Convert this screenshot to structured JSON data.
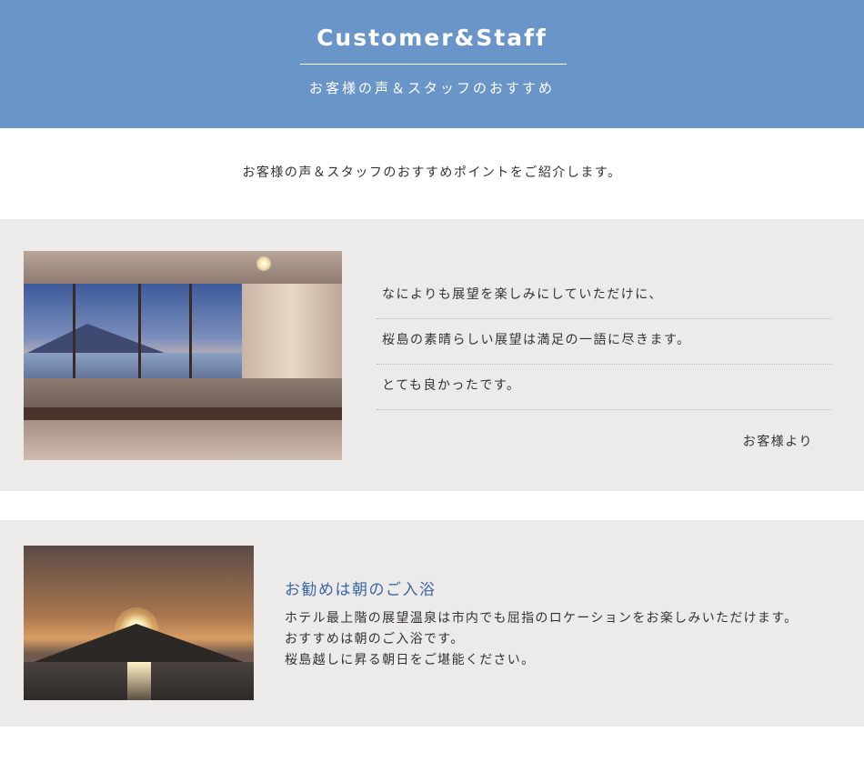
{
  "header": {
    "title": "Customer&Staff",
    "subtitle": "お客様の声＆スタッフのおすすめ",
    "background_color": "#6a95c8"
  },
  "intro": "お客様の声＆スタッフのおすすめポイントをご紹介します。",
  "customer_voice": {
    "lines": [
      "なによりも展望を楽しみにしていただけに、",
      "桜島の素晴らしい展望は満足の一語に尽きます。",
      "とても良かったです。"
    ],
    "signature": "お客様より"
  },
  "staff_recommendation": {
    "heading": "お勧めは朝のご入浴",
    "body": [
      "ホテル最上階の展望温泉は市内でも屈指のロケーションをお楽しみいただけます。",
      "おすすめは朝のご入浴です。",
      "桜島越しに昇る朝日をご堪能ください。"
    ],
    "heading_color": "#3b67a6"
  },
  "panel_color": "#ecebe9"
}
